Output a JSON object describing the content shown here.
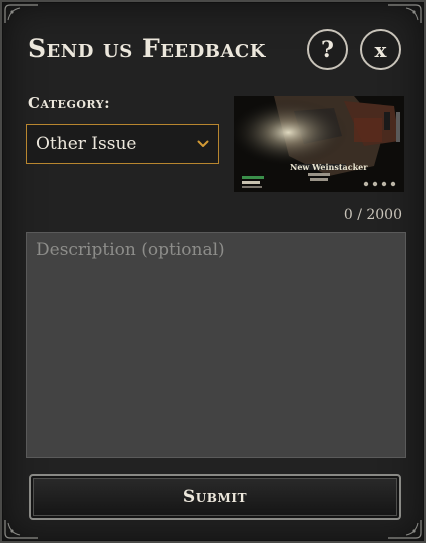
{
  "dialog": {
    "title": "Send us Feedback",
    "help_label": "?",
    "close_label": "x"
  },
  "category": {
    "label": "Category:",
    "selected": "Other Issue"
  },
  "screenshot": {
    "caption": "New Weinstacker"
  },
  "description": {
    "placeholder": "Description (optional)",
    "value": "",
    "char_count": "0 / 2000"
  },
  "submit": {
    "label": "Submit"
  },
  "colors": {
    "panel_bg": "#222222",
    "border": "#4a4a48",
    "accent_gold": "#b8862f",
    "text": "#ece7dc",
    "field_bg": "#434343"
  }
}
